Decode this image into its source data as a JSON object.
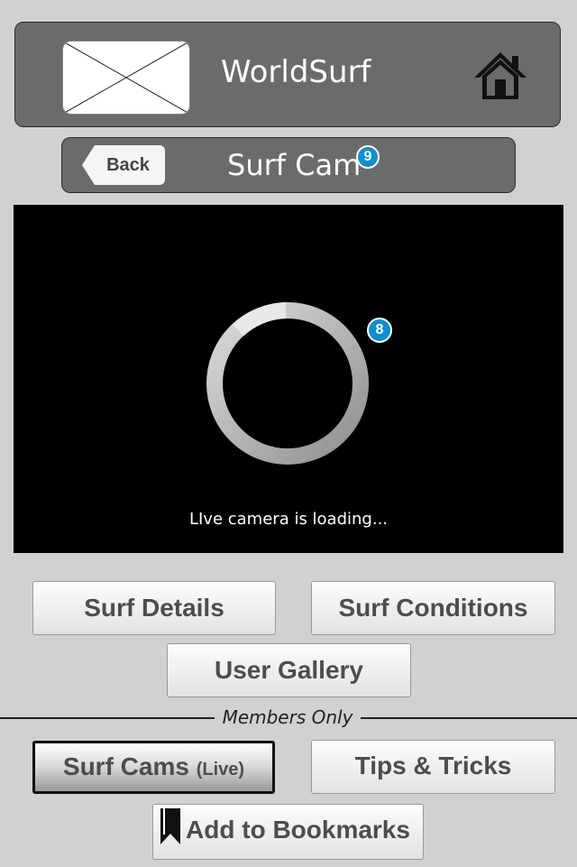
{
  "header": {
    "title": "WorldSurf",
    "logo_icon": "image-placeholder-icon",
    "home_icon": "home-icon"
  },
  "subheader": {
    "back_label": "Back",
    "title": "Surf Cam",
    "title_badge": "9"
  },
  "camera": {
    "loading_text": "LIve camera is loading...",
    "spinner_badge": "8"
  },
  "buttons": {
    "surf_details": "Surf Details",
    "surf_conditions": "Surf Conditions",
    "user_gallery": "User Gallery"
  },
  "members": {
    "divider_label": "Members Only",
    "surf_cams": "Surf Cams",
    "surf_cams_suffix": "(Live)",
    "tips": "Tips & Tricks",
    "bookmarks": "Add to Bookmarks",
    "bookmark_icon": "bookmark-icon"
  },
  "colors": {
    "header_bg": "#6b6b6b",
    "badge": "#0d8fd0",
    "page_bg": "#d1d1d1"
  }
}
